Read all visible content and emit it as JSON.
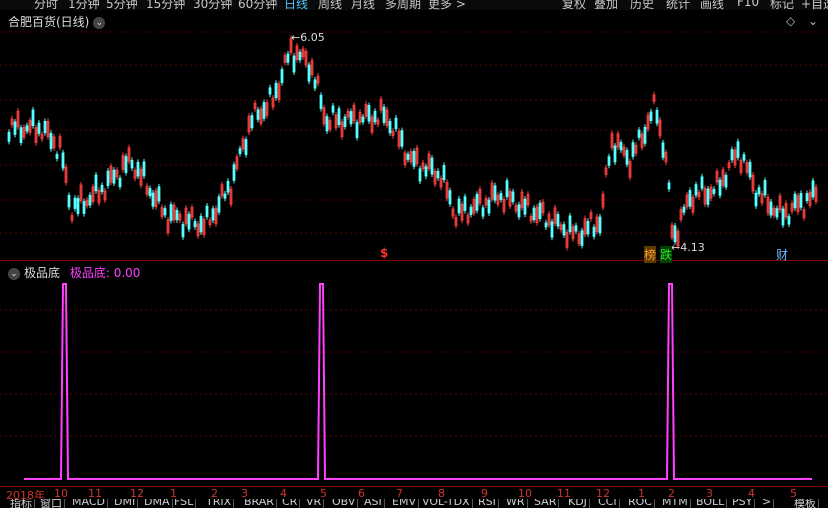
{
  "top_toolbar": {
    "periods": [
      "分时",
      "1分钟",
      "5分钟",
      "15分钟",
      "30分钟",
      "60分钟",
      "日线",
      "周线",
      "月线",
      "多周期",
      "更多 >"
    ],
    "active_period": "日线",
    "buttons": [
      "复权",
      "叠加",
      "历史",
      "统计",
      "画线",
      "F10",
      "标记",
      "+自选"
    ]
  },
  "main_chart": {
    "title": "合肥百货(日线)",
    "high_label": "6.05",
    "low_label": "4.13",
    "markers": [
      {
        "text": "$",
        "color": "#ff3030"
      },
      {
        "text": "榜",
        "color": "#ff9a30"
      },
      {
        "text": "跌",
        "color": "#30e030"
      },
      {
        "text": "财",
        "color": "#6fb8ff"
      }
    ],
    "colors": {
      "up": "#ff4040",
      "down": "#54ffff",
      "grid": "#7a0000",
      "border": "#8b0000"
    }
  },
  "indicator": {
    "name": "极品底",
    "value_label": "极品底: 0.00",
    "color": "#ff40ff"
  },
  "time_axis": {
    "labels": [
      "2018年",
      "10",
      "11",
      "12",
      "1",
      "2",
      "3",
      "4",
      "5",
      "6",
      "7",
      "8",
      "9",
      "10",
      "11",
      "12",
      "1",
      "2",
      "3",
      "4",
      "5"
    ]
  },
  "bottom_tabs": [
    "指标",
    "窗口",
    "MACD",
    "DMI",
    "DMA",
    "FSL",
    "TRIX",
    "BRAR",
    "CR",
    "VR",
    "OBV",
    "ASI",
    "EMV",
    "VOL-TDX",
    "RSI",
    "WR",
    "SAR",
    "KDJ",
    "CCI",
    "ROC",
    "MTM",
    "BOLL",
    "PSY",
    ">",
    "模板"
  ]
}
